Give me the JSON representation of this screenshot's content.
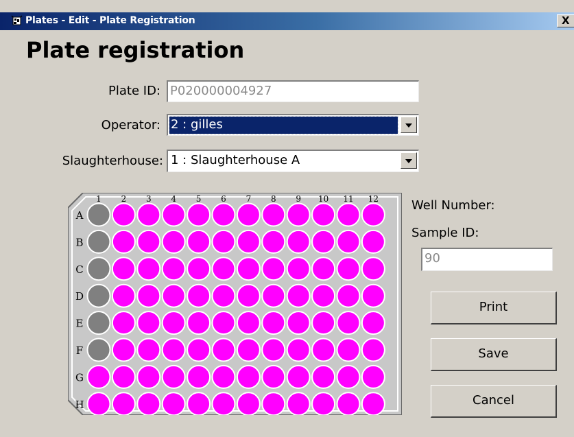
{
  "window": {
    "title": "Plates - Edit - Plate Registration",
    "close_label": "X"
  },
  "heading": "Plate registration",
  "form": {
    "plate_id_label": "Plate ID:",
    "plate_id_value": "P020000004927",
    "operator_label": "Operator:",
    "operator_value": "2 : gilles",
    "slaughterhouse_label": "Slaughterhouse:",
    "slaughterhouse_value": "1 : Slaughterhouse A"
  },
  "plate": {
    "columns": [
      "1",
      "2",
      "3",
      "4",
      "5",
      "6",
      "7",
      "8",
      "9",
      "10",
      "11",
      "12"
    ],
    "rows": [
      "A",
      "B",
      "C",
      "D",
      "E",
      "F",
      "G",
      "H"
    ],
    "well_states": [
      "GMMMMMMMMMMM",
      "GMMMMMMMMMMM",
      "GMMMMMMMMMMM",
      "GMMMMMMMMMMM",
      "GMMMMMMMMMMM",
      "GMMMMMMMMMMM",
      "MMMMMMMMMMMM",
      "MMMMMMMMMMMM"
    ],
    "colors": {
      "filled": "#ff00ff",
      "empty": "#808080",
      "plate_body": "#c8c8c8"
    }
  },
  "side": {
    "well_number_label": "Well Number:",
    "sample_id_label": "Sample ID:",
    "sample_id_value": "90"
  },
  "buttons": {
    "print": "Print",
    "save": "Save",
    "cancel": "Cancel"
  }
}
